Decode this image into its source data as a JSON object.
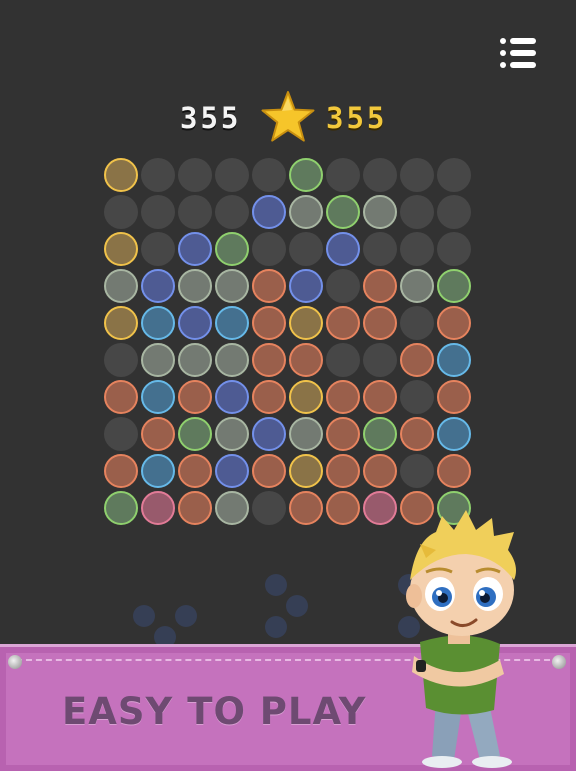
{
  "scores": {
    "current": "355",
    "best": "355"
  },
  "banner": {
    "text": "EASY TO PLAY"
  },
  "icons": {
    "menu": "menu-list-icon",
    "star": "star-icon",
    "mascot": "cartoon-boy-mascot"
  },
  "colors": {
    "background": "#323232",
    "empty": "#474747",
    "banner": "#c572bd",
    "banner_text": "#6e4a72",
    "star": "#f6c52a",
    "piece_slot": "#363f55"
  },
  "palette": {
    "Y": {
      "fill": "#8a7347",
      "ring": "#f0c24a"
    },
    "G": {
      "fill": "#5f7a5d",
      "ring": "#8fd06e"
    },
    "B": {
      "fill": "#4e5b93",
      "ring": "#7390ea"
    },
    "S": {
      "fill": "#737a72",
      "ring": "#a8b6a2"
    },
    "O": {
      "fill": "#9a5f4b",
      "ring": "#e6835e"
    },
    "C": {
      "fill": "#44708f",
      "ring": "#66b9e8"
    },
    "P": {
      "fill": "#985a6c",
      "ring": "#e27b97"
    }
  },
  "board": {
    "size": 10,
    "rows": [
      "Y....G....",
      "....BSGS..",
      "Y.BG..B...",
      "SBSSOB.OSG",
      "YCBCOYOO.O",
      ".SSSOO..OC",
      "OCOBOYOO.O",
      ".OGSBSOGOC",
      "OCOBOYOO.O",
      "GPOS.OOPOG"
    ]
  },
  "next_pieces": {
    "count": 3,
    "cell_size": 3,
    "shapes": [
      [
        "...",
        "X.X",
        ".X."
      ],
      [
        "X..",
        ".X.",
        "X.."
      ],
      [
        "X..",
        "...",
        "X.."
      ]
    ]
  }
}
